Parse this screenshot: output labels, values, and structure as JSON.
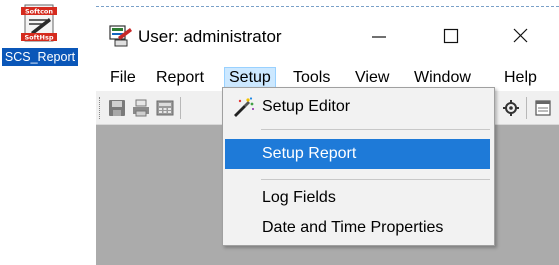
{
  "desktop": {
    "shortcut": {
      "icon_name": "softcon-softhsp-app-icon",
      "icon_text_top": "Softcon",
      "icon_text_bottom": "SoftHsp",
      "label": "SCS_Report"
    }
  },
  "window": {
    "title": "User: administrator",
    "app_icon": "report-app-icon",
    "buttons": {
      "minimize": "minimize-icon",
      "maximize": "maximize-icon",
      "close": "close-icon"
    }
  },
  "menubar": {
    "items": [
      {
        "label": "File"
      },
      {
        "label": "Report"
      },
      {
        "label": "Setup",
        "active": true
      },
      {
        "label": "Tools"
      },
      {
        "label": "View"
      },
      {
        "label": "Window"
      },
      {
        "label": "Help"
      }
    ]
  },
  "toolbar": {
    "icons": [
      "save-icon",
      "print-icon",
      "calculator-icon",
      "settings-icon",
      "window-icon"
    ]
  },
  "setup_menu": {
    "items": [
      {
        "label": "Setup Editor",
        "icon": "setup-editor-icon"
      },
      {
        "label": "Setup Report",
        "highlighted": true
      },
      {
        "label": "Log Fields"
      },
      {
        "label": "Date and Time Properties"
      }
    ]
  },
  "colors": {
    "highlight": "#1e7ad8",
    "menu_active": "#cce8ff",
    "workarea": "#ababab",
    "desktop_label_bg": "#0a56b8"
  }
}
